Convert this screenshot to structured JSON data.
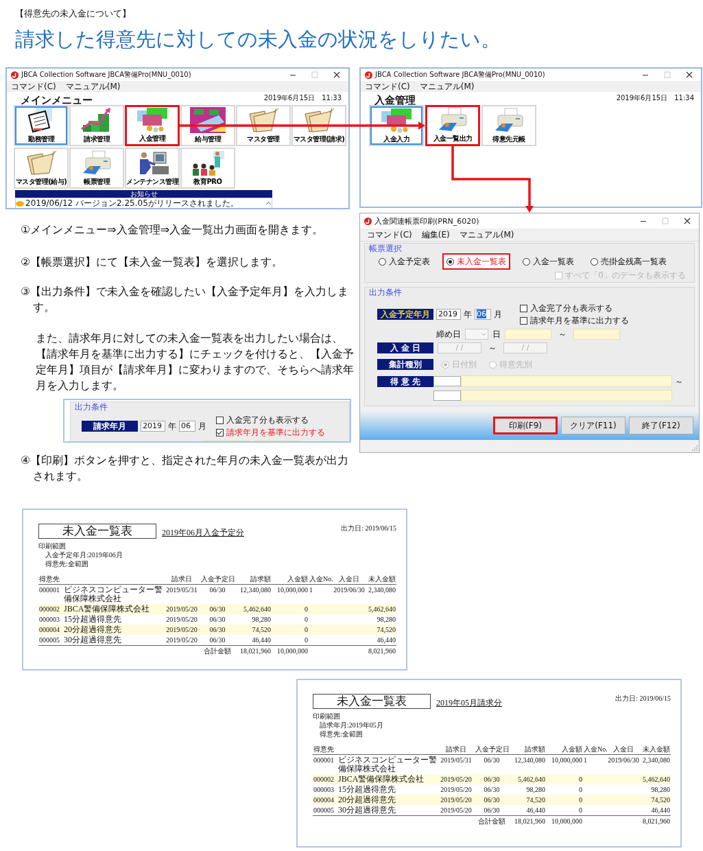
{
  "header": {
    "note": "【得意先の未入金について】",
    "title": "請求した得意先に対しての未入金の状況をしりたい。"
  },
  "main_menu": {
    "title": "JBCA Collection Software JBCA警備Pro(MNU_0010)",
    "menu": [
      "コマンド(C)",
      "マニュアル(M)"
    ],
    "heading": "メインメニュー",
    "datetime": "2019年6月15日　11:33",
    "tiles": [
      {
        "label": "勤務管理",
        "selected": true,
        "highlighted": false
      },
      {
        "label": "請求管理",
        "selected": false,
        "highlighted": false
      },
      {
        "label": "入金管理",
        "selected": false,
        "highlighted": true
      },
      {
        "label": "給与管理",
        "selected": false,
        "highlighted": false
      },
      {
        "label": "マスタ管理",
        "selected": false,
        "highlighted": false
      },
      {
        "label": "マスタ管理(請求)",
        "selected": false,
        "highlighted": false
      },
      {
        "label": "マスタ管理(給与)",
        "selected": false,
        "highlighted": false
      },
      {
        "label": "帳票管理",
        "selected": false,
        "highlighted": false
      },
      {
        "label": "メンテナンス管理",
        "selected": false,
        "highlighted": false
      },
      {
        "label": "教育PRO",
        "selected": false,
        "highlighted": false
      }
    ],
    "notice": {
      "title": "お知らせ",
      "text": "2019/06/12 バージョン2.25.05がリリースされました。"
    }
  },
  "payment_menu": {
    "title": "JBCA Collection Software JBCA警備Pro(MNU_0010)",
    "menu": [
      "コマンド(C)",
      "マニュアル(M)"
    ],
    "heading": "入金管理",
    "datetime": "2019年6月15日　11:34",
    "tiles": [
      {
        "label": "入金入力",
        "selected": true,
        "highlighted": false
      },
      {
        "label": "入金一覧出力",
        "selected": false,
        "highlighted": true
      },
      {
        "label": "得意先元帳",
        "selected": false,
        "highlighted": false
      }
    ]
  },
  "steps": [
    {
      "text": "①メインメニュー⇒入金管理⇒入金一覧出力画面を開きます。"
    },
    {
      "text": "②【帳票選択】にて【未入金一覧表】を選択します。"
    },
    {
      "text": "③【出力条件】で未入金を確認したい【入金予定年月】を入力します。",
      "note": "また、請求年月に対しての未入金一覧表を出力したい場合は、【請求年月を基準に出力する】にチェックを付けると、【入金予定年月】項目が【請求年月】に変わりますので、そちらへ請求年月を入力します。",
      "example": {
        "legend": "出力条件",
        "field_label": {
          "text": "請求年月",
          "active": false
        },
        "year": "2019",
        "year_unit": "年",
        "month": {
          "value": "06",
          "selected": false
        },
        "month_unit": "月",
        "checkboxes": [
          {
            "label": "入金完了分も表示する",
            "checked": false,
            "emphasized": false
          },
          {
            "label": "請求年月を基準に出力する",
            "checked": true,
            "emphasized": true
          }
        ]
      }
    },
    {
      "text": "④【印刷】ボタンを押すと、指定された年月の未入金一覧表が出力されます。"
    }
  ],
  "dialog": {
    "title": "入金関連帳票印刷(PRN_6020)",
    "menu": [
      "コマンド(C)",
      "編集(E)",
      "マニュアル(M)"
    ],
    "report_selection": {
      "legend": "帳票選択",
      "options": [
        {
          "label": "入金予定表",
          "selected": false,
          "highlighted": false
        },
        {
          "label": "未入金一覧表",
          "selected": true,
          "highlighted": true
        },
        {
          "label": "入金一覧表",
          "selected": false,
          "highlighted": false
        },
        {
          "label": "売掛金残高一覧表",
          "selected": false,
          "highlighted": false
        }
      ],
      "zero_option": {
        "label": "すべて「0」のデータも表示する",
        "checked": false,
        "disabled": true
      }
    },
    "conditions": {
      "legend": "出力条件",
      "field_label": {
        "text": "入金予定年月",
        "active": true
      },
      "year": "2019",
      "year_unit": "年",
      "month": {
        "value": "06",
        "selected": true
      },
      "month_unit": "月",
      "checkboxes": [
        {
          "label": "入金完了分も表示する",
          "checked": false,
          "emphasized": false
        },
        {
          "label": "請求年月を基準に出力する",
          "checked": false,
          "emphasized": false
        }
      ],
      "closing_day": {
        "label": "締め日",
        "unit": "日",
        "separator": "～"
      },
      "payment_date": {
        "label": "入 金 日",
        "from": "/ /",
        "separator": "～",
        "to": "/ /"
      },
      "summary_type": {
        "label": "集計種別",
        "disabled": true,
        "options": [
          {
            "label": "日付別",
            "selected": true
          },
          {
            "label": "得意先別",
            "selected": false
          }
        ]
      },
      "customer": {
        "label": "得 意 先",
        "separator": "～"
      }
    },
    "buttons": [
      {
        "label": "印刷(F9)",
        "highlighted": true
      },
      {
        "label": "クリア(F11)",
        "highlighted": false
      },
      {
        "label": "終了(F12)",
        "highlighted": false
      }
    ]
  },
  "reports": [
    {
      "title": "未入金一覧表",
      "subtitle": "2019年06月入金予定分",
      "output_date": "出力日: 2019/06/15",
      "range_label": "印刷範囲",
      "range_lines": [
        "入金予定年月:2019年06月",
        "得意先:全範囲"
      ],
      "columns": [
        "得意先",
        "請求日",
        "入金予定日",
        "請求額",
        "入金額",
        "入金No.",
        "入金日",
        "未入金額"
      ],
      "rows": [
        {
          "code": "000001",
          "name": "ビジネスコンピューター警備保障株式会社",
          "billing_date": "2019/05/31",
          "due": "06/30",
          "billed": "12,340,080",
          "paid": "10,000,000",
          "payment_no": "1",
          "payment_date": "2019/06/30",
          "unpaid": "2,340,080"
        },
        {
          "code": "000002",
          "name": "JBCA警備保障株式会社",
          "billing_date": "2019/05/20",
          "due": "06/30",
          "billed": "5,462,640",
          "paid": "0",
          "unpaid": "5,462,640"
        },
        {
          "code": "000003",
          "name": "15分超過得意先",
          "billing_date": "2019/05/20",
          "due": "06/30",
          "billed": "98,280",
          "paid": "0",
          "unpaid": "98,280"
        },
        {
          "code": "000004",
          "name": "20分超過得意先",
          "billing_date": "2019/05/20",
          "due": "06/30",
          "billed": "74,520",
          "paid": "0",
          "unpaid": "74,520"
        },
        {
          "code": "000005",
          "name": "30分超過得意先",
          "billing_date": "2019/05/20",
          "due": "06/30",
          "billed": "46,440",
          "paid": "0",
          "unpaid": "46,440"
        }
      ],
      "total": {
        "label": "合計金額",
        "billed": "18,021,960",
        "paid": "10,000,000",
        "unpaid": "8,021,960"
      }
    },
    {
      "title": "未入金一覧表",
      "subtitle": "2019年05月請求分",
      "output_date": "出力日: 2019/06/15",
      "range_label": "印刷範囲",
      "range_lines": [
        "請求年月:2019年05月",
        "得意先:全範囲"
      ],
      "columns": [
        "得意先",
        "請求日",
        "入金予定日",
        "請求額",
        "入金額",
        "入金No.",
        "入金日",
        "未入金額"
      ],
      "rows": [
        {
          "code": "000001",
          "name": "ビジネスコンピューター警備保障株式会社",
          "billing_date": "2019/05/31",
          "due": "06/30",
          "billed": "12,340,080",
          "paid": "10,000,000",
          "payment_no": "1",
          "payment_date": "2019/06/30",
          "unpaid": "2,340,080"
        },
        {
          "code": "000002",
          "name": "JBCA警備保障株式会社",
          "billing_date": "2019/05/20",
          "due": "06/30",
          "billed": "5,462,640",
          "paid": "0",
          "unpaid": "5,462,640"
        },
        {
          "code": "000003",
          "name": "15分超過得意先",
          "billing_date": "2019/05/20",
          "due": "06/30",
          "billed": "98,280",
          "paid": "0",
          "unpaid": "98,280"
        },
        {
          "code": "000004",
          "name": "20分超過得意先",
          "billing_date": "2019/05/20",
          "due": "06/30",
          "billed": "74,520",
          "paid": "0",
          "unpaid": "74,520"
        },
        {
          "code": "000005",
          "name": "30分超過得意先",
          "billing_date": "2019/05/20",
          "due": "06/30",
          "billed": "46,440",
          "paid": "0",
          "unpaid": "46,440"
        }
      ],
      "total": {
        "label": "合計金額",
        "billed": "18,021,960",
        "paid": "10,000,000",
        "unpaid": "8,021,960"
      }
    }
  ]
}
